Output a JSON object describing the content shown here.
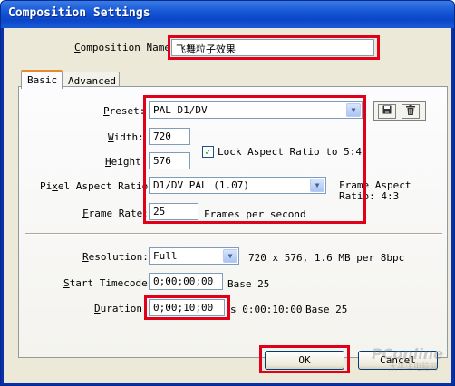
{
  "window": {
    "title": "Composition Settings"
  },
  "composition_name": {
    "label_pre": "",
    "label_u": "C",
    "label_post": "omposition Name:",
    "value": "飞舞粒子效果"
  },
  "tabs": [
    {
      "label": "Basic",
      "active": true
    },
    {
      "label": "Advanced",
      "active": false
    }
  ],
  "preset": {
    "label_u": "P",
    "label_post": "reset:",
    "value": "PAL D1/DV",
    "save_icon": "disk-icon",
    "delete_icon": "trash-icon"
  },
  "width": {
    "label_u": "W",
    "label_post": "idth:",
    "value": "720"
  },
  "height": {
    "label_u": "H",
    "label_post": "eight:",
    "value": "576"
  },
  "lock_aspect": {
    "checked": true,
    "label": "Lock Aspect Ratio to 5:4"
  },
  "pixel_aspect": {
    "label_pre": "Pi",
    "label_u": "x",
    "label_post": "el Aspect Ratio:",
    "value": "D1/DV PAL (1.07)"
  },
  "frame_aspect": {
    "line1": "Frame Aspect",
    "line2": "Ratio: 4:3"
  },
  "frame_rate": {
    "label_u": "F",
    "label_post": "rame Rate:",
    "value": "25",
    "unit": "Frames per second"
  },
  "resolution": {
    "label_u": "R",
    "label_post": "esolution:",
    "value": "Full",
    "info": "720 x 576, 1.6 MB per 8bpc"
  },
  "start_timecode": {
    "label_pre": "",
    "label_u": "S",
    "label_post": "tart Timecode:",
    "value": "0;00;00;00",
    "base": "Base 25"
  },
  "duration": {
    "label_u": "D",
    "label_post": "uration:",
    "value": "0;00;10;00",
    "info_tail": "s 0:00:10:00",
    "base": "Base 25"
  },
  "buttons": {
    "ok": "OK",
    "cancel": "Cancel"
  },
  "watermark": {
    "brand": "PConline",
    "sub": "太平洋电脑网"
  },
  "colors": {
    "highlight": "#e0001a",
    "titlebar": "#0b46c8"
  }
}
